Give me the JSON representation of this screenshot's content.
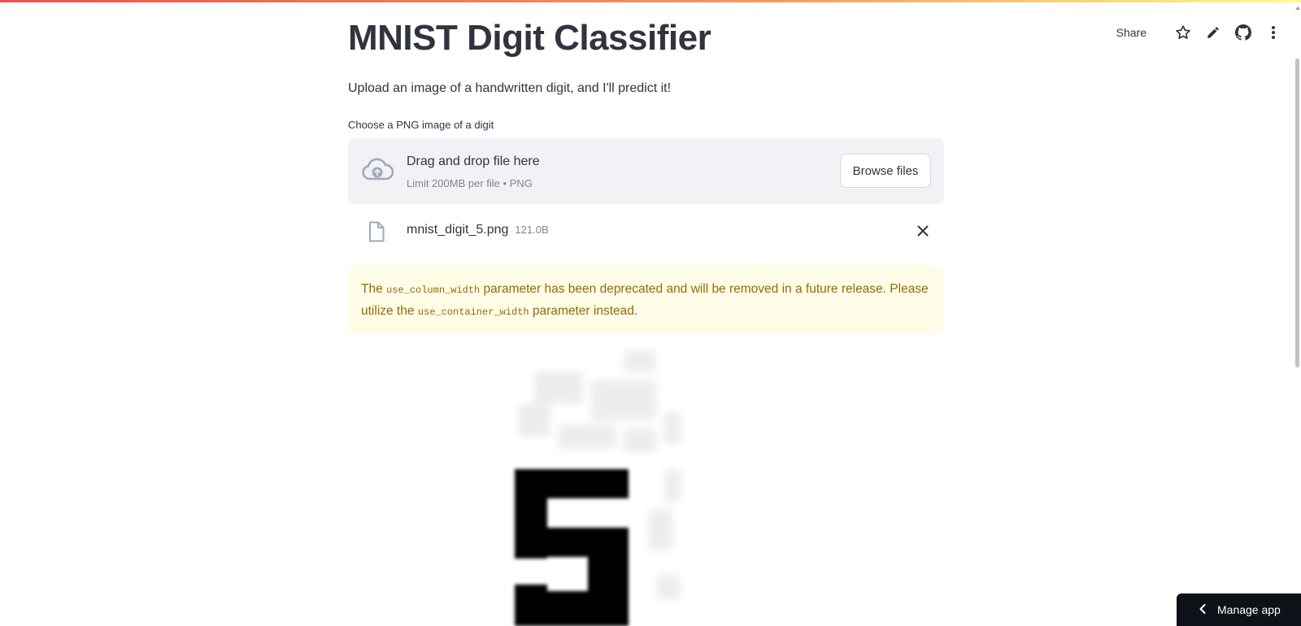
{
  "toolbar": {
    "share_label": "Share",
    "icons": [
      "star-icon",
      "pencil-icon",
      "github-icon",
      "more-vertical-icon"
    ]
  },
  "app": {
    "title": "MNIST Digit Classifier",
    "subtitle": "Upload an image of a handwritten digit, and I'll predict it!"
  },
  "uploader": {
    "label": "Choose a PNG image of a digit",
    "drop_text": "Drag and drop file here",
    "limit_text": "Limit 200MB per file • PNG",
    "browse_label": "Browse files",
    "icon": "cloud-upload-icon"
  },
  "file": {
    "name": "mnist_digit_5.png",
    "size": "121.0B",
    "icon": "file-icon"
  },
  "warning": {
    "part1": "The ",
    "code1": "use_column_width",
    "part2": " parameter has been deprecated and will be removed in a future release. Please utilize the ",
    "code2": "use_container_width",
    "part3": " parameter instead.",
    "color": "#926c05",
    "background": "#fffce7"
  },
  "image": {
    "depicts": "5"
  },
  "footer": {
    "manage_label": "Manage app"
  },
  "colors": {
    "text": "#31333f",
    "muted": "#808495",
    "dropzone_bg": "#f0f2f6",
    "footer_bg": "#0e1117"
  }
}
